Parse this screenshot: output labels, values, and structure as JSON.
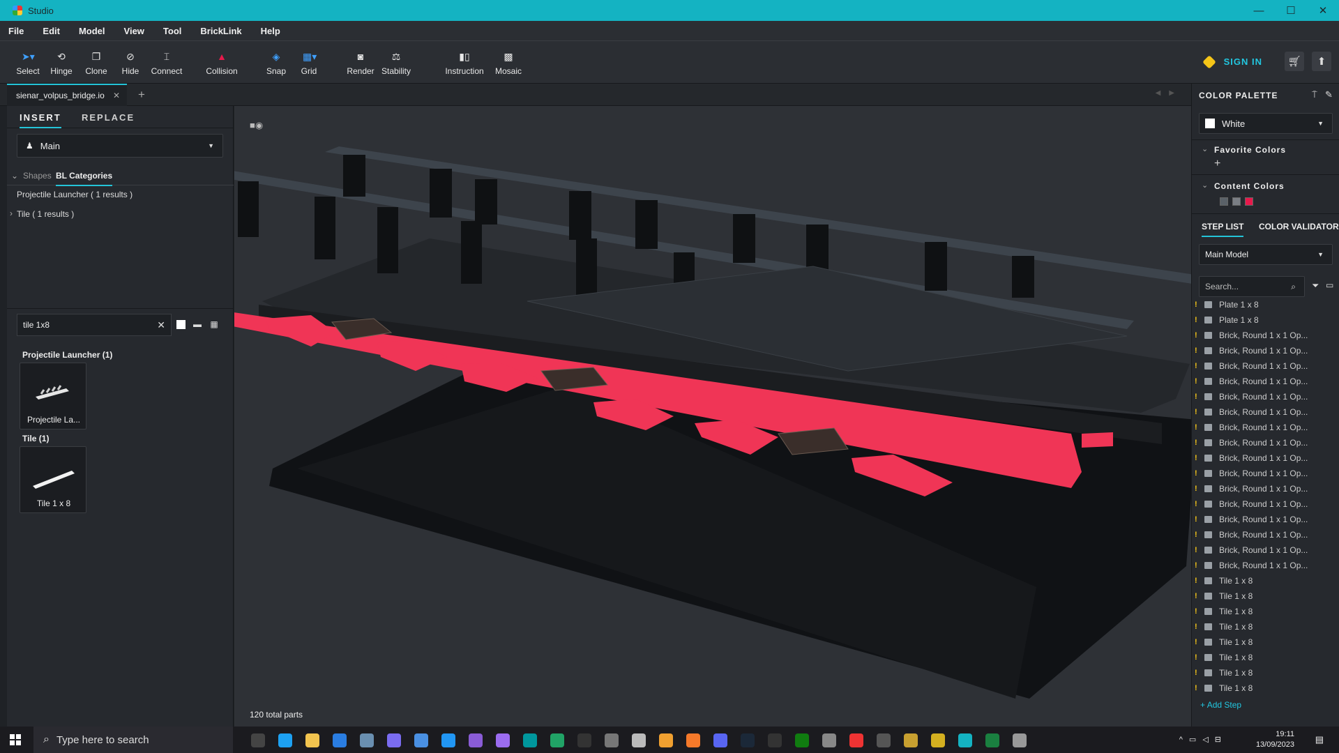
{
  "window": {
    "title": "Studio",
    "controls": [
      "minimize-icon",
      "maximize-icon",
      "close-icon"
    ]
  },
  "menu": [
    "File",
    "Edit",
    "Model",
    "View",
    "Tool",
    "BrickLink",
    "Help"
  ],
  "toolbar": {
    "tools": [
      {
        "label": "Select",
        "icon": "cursor-icon"
      },
      {
        "label": "Hinge",
        "icon": "hinge-icon"
      },
      {
        "label": "Clone",
        "icon": "clone-icon"
      },
      {
        "label": "Hide",
        "icon": "hide-icon"
      },
      {
        "label": "Connect",
        "icon": "connect-icon"
      },
      {
        "label": "Collision",
        "icon": "collision-icon",
        "color": "#e8194b"
      },
      {
        "label": "Snap",
        "icon": "snap-icon",
        "color": "#3fa0ff"
      },
      {
        "label": "Grid",
        "icon": "grid-icon",
        "color": "#3fa0ff"
      },
      {
        "label": "Render",
        "icon": "camera-icon"
      },
      {
        "label": "Stability",
        "icon": "stability-icon"
      },
      {
        "label": "Instruction",
        "icon": "instruction-icon"
      },
      {
        "label": "Mosaic",
        "icon": "mosaic-icon"
      }
    ],
    "signin": "SIGN IN"
  },
  "tabs": {
    "document": "sienar_volpus_bridge.io"
  },
  "left": {
    "tabs": [
      "INSERT",
      "REPLACE"
    ],
    "palette_select": "Main",
    "category_tabs": [
      "Shapes",
      "BL Categories"
    ],
    "categories": [
      "Projectile Launcher ( 1 results )",
      "Tile ( 1 results )"
    ],
    "search_value": "tile 1x8",
    "groups": [
      {
        "title": "Projectile Launcher (1)",
        "item": "Projectile La..."
      },
      {
        "title": "Tile (1)",
        "item": "Tile 1 x 8"
      }
    ]
  },
  "viewport": {
    "status": "120 total parts"
  },
  "right": {
    "color_palette_title": "COLOR PALETTE",
    "selected_color": "White",
    "favorite_colors": "Favorite Colors",
    "content_colors": "Content Colors",
    "content_swatches": [
      "#5a6168",
      "#7a7e84",
      "#e8194b"
    ],
    "step_tabs": [
      "STEP LIST",
      "COLOR VALIDATOR"
    ],
    "model_select": "Main Model",
    "search_placeholder": "Search...",
    "steps": [
      "Plate 1 x 8",
      "Plate 1 x 8",
      "Brick, Round 1 x 1 Op...",
      "Brick, Round 1 x 1 Op...",
      "Brick, Round 1 x 1 Op...",
      "Brick, Round 1 x 1 Op...",
      "Brick, Round 1 x 1 Op...",
      "Brick, Round 1 x 1 Op...",
      "Brick, Round 1 x 1 Op...",
      "Brick, Round 1 x 1 Op...",
      "Brick, Round 1 x 1 Op...",
      "Brick, Round 1 x 1 Op...",
      "Brick, Round 1 x 1 Op...",
      "Brick, Round 1 x 1 Op...",
      "Brick, Round 1 x 1 Op...",
      "Brick, Round 1 x 1 Op...",
      "Brick, Round 1 x 1 Op...",
      "Brick, Round 1 x 1 Op...",
      "Tile 1 x 8",
      "Tile 1 x 8",
      "Tile 1 x 8",
      "Tile 1 x 8",
      "Tile 1 x 8",
      "Tile 1 x 8",
      "Tile 1 x 8",
      "Tile 1 x 8"
    ],
    "add_step": "Add Step"
  },
  "taskbar": {
    "search_placeholder": "Type here to search",
    "time": "19:11",
    "date": "13/09/2023"
  }
}
